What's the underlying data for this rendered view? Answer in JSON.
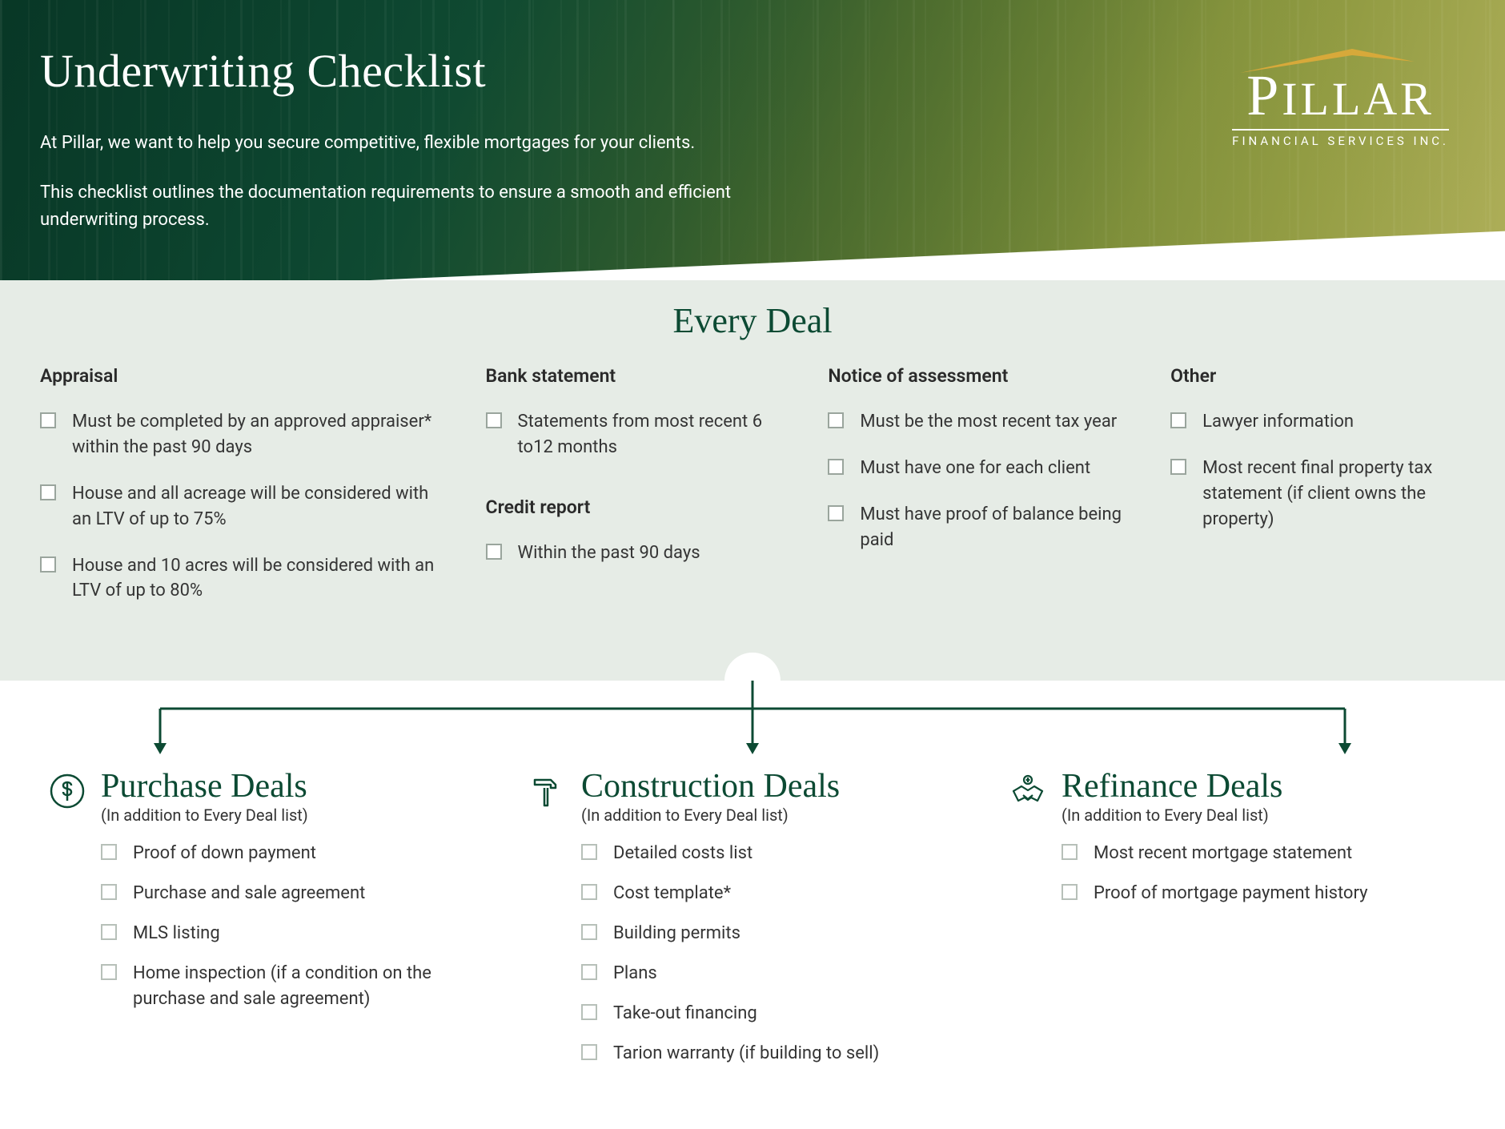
{
  "hero": {
    "title": "Underwriting Checklist",
    "p1": "At Pillar, we want to help you secure competitive, flexible mortgages for your clients.",
    "p2": "This checklist outlines the documentation requirements to ensure a smooth and efficient underwriting process."
  },
  "logo": {
    "brand_first": "P",
    "brand_rest": "ILLAR",
    "tagline": "FINANCIAL SERVICES INC."
  },
  "every_deal": {
    "heading": "Every Deal",
    "appraisal": {
      "title": "Appraisal",
      "items": [
        "Must be completed by an approved appraiser* within the past 90 days",
        "House and all acreage will be considered with an LTV of up to 75%",
        "House and 10 acres will be considered with an LTV of up to 80%"
      ]
    },
    "bank": {
      "title": "Bank statement",
      "items": [
        "Statements from most recent 6 to12 months"
      ]
    },
    "credit": {
      "title": "Credit report",
      "items": [
        "Within the past 90 days"
      ]
    },
    "noa": {
      "title": "Notice of assessment",
      "items": [
        "Must be the most recent tax year",
        "Must have one for each client",
        "Must have proof of balance being paid"
      ]
    },
    "other": {
      "title": "Other",
      "items": [
        "Lawyer information",
        "Most recent final property tax statement (if client owns the property)"
      ]
    }
  },
  "deals": {
    "subtitle": "(In addition to Every Deal list)",
    "purchase": {
      "title": "Purchase Deals",
      "items": [
        "Proof of down payment",
        "Purchase and sale agreement",
        "MLS listing",
        "Home inspection (if a condition on the purchase and sale agreement)"
      ]
    },
    "construction": {
      "title": "Construction Deals",
      "items": [
        "Detailed costs list",
        "Cost template*",
        "Building permits",
        "Plans",
        "Take-out financing",
        "Tarion warranty (if building to sell)"
      ]
    },
    "refinance": {
      "title": "Refinance Deals",
      "items": [
        "Most recent mortgage statement",
        "Proof of mortgage payment history"
      ]
    }
  }
}
